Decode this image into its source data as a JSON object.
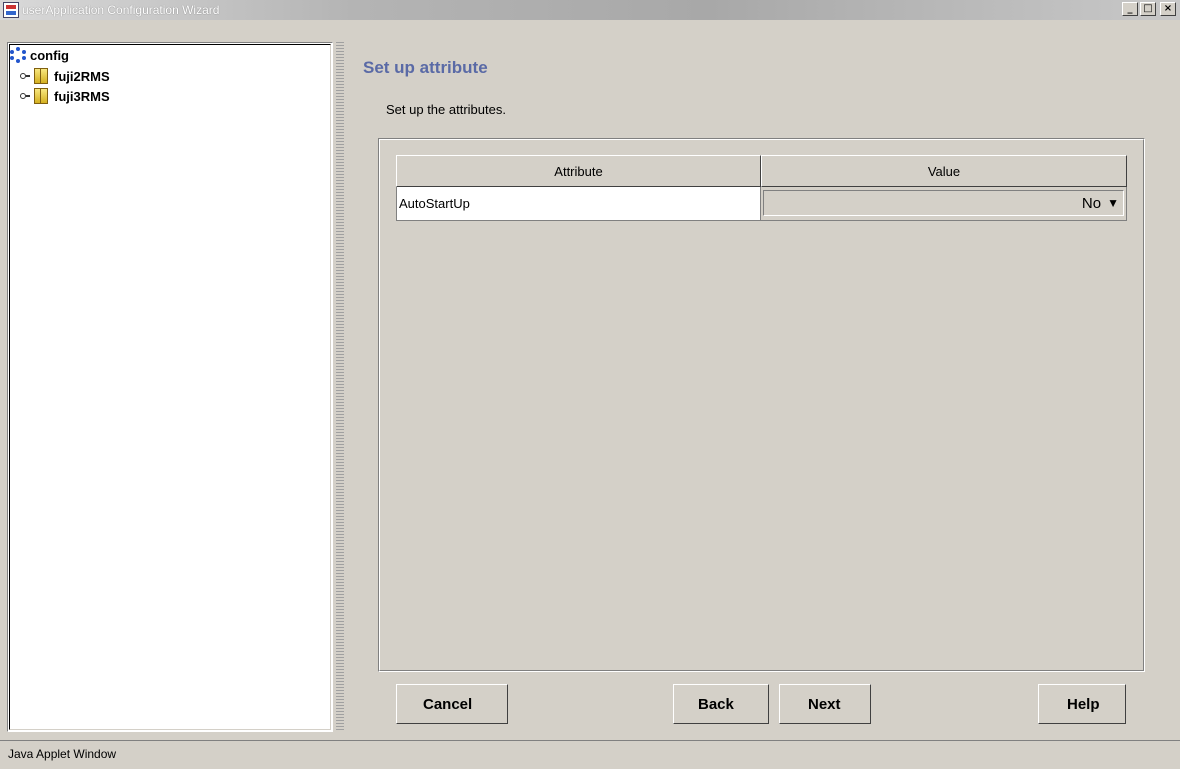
{
  "window": {
    "title": "userApplication Configuration Wizard",
    "icon": "java-app-icon",
    "controls": {
      "minimize": "_",
      "maximize": "□",
      "close": "×"
    }
  },
  "tree": {
    "root": {
      "label": "config",
      "icon": "config-node-icon"
    },
    "nodes": [
      {
        "label": "fuji2RMS",
        "icon": "host-icon",
        "expanded": false
      },
      {
        "label": "fuji3RMS",
        "icon": "host-icon",
        "expanded": false
      }
    ]
  },
  "main": {
    "heading": "Set up attribute",
    "description": "Set up the attributes.",
    "table": {
      "columns": [
        "Attribute",
        "Value"
      ],
      "rows": [
        {
          "attribute": "AutoStartUp",
          "value": "No"
        }
      ]
    }
  },
  "buttons": {
    "cancel": "Cancel",
    "back": "Back",
    "next": "Next",
    "help": "Help"
  },
  "statusbar": {
    "text": "Java Applet Window"
  },
  "colors": {
    "background": "#d4d0c8",
    "heading": "#5a6aa6"
  }
}
